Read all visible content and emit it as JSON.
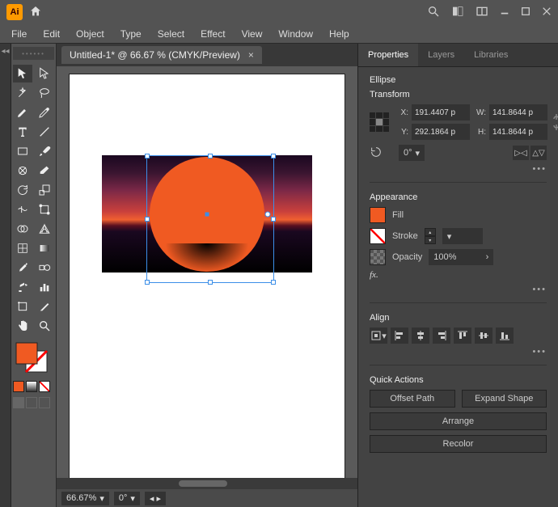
{
  "app": {
    "abbrev": "Ai"
  },
  "menu": [
    "File",
    "Edit",
    "Object",
    "Type",
    "Select",
    "Effect",
    "View",
    "Window",
    "Help"
  ],
  "document": {
    "tab_title": "Untitled-1* @ 66.67 % (CMYK/Preview)",
    "zoom": "66.67%",
    "rotation": "0°"
  },
  "selection": {
    "shape": "Ellipse"
  },
  "panels": {
    "tabs": [
      "Properties",
      "Layers",
      "Libraries"
    ],
    "active": "Properties"
  },
  "transform": {
    "title": "Transform",
    "x_lbl": "X:",
    "x": "191.4407 p",
    "y_lbl": "Y:",
    "y": "292.1864 p",
    "w_lbl": "W:",
    "w": "141.8644 p",
    "h_lbl": "H:",
    "h": "141.8644 p",
    "rotate_lbl": "⟲:",
    "rotate": "0°"
  },
  "appearance": {
    "title": "Appearance",
    "fill_lbl": "Fill",
    "fill_color": "#f05a22",
    "stroke_lbl": "Stroke",
    "opacity_lbl": "Opacity",
    "opacity": "100%",
    "fx_lbl": "fx."
  },
  "align": {
    "title": "Align"
  },
  "quick_actions": {
    "title": "Quick Actions",
    "offset": "Offset Path",
    "expand": "Expand Shape",
    "arrange": "Arrange",
    "recolor": "Recolor"
  },
  "more": "•••"
}
